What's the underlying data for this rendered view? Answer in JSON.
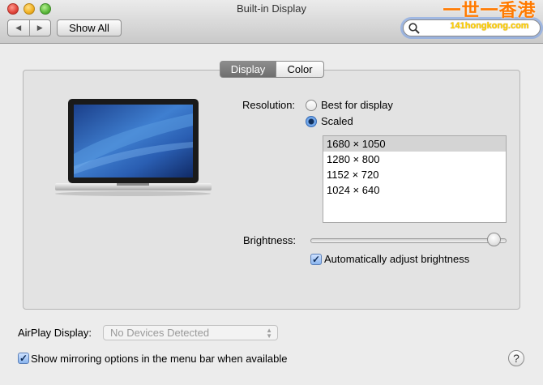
{
  "window": {
    "title": "Built-in Display"
  },
  "toolbar": {
    "back_glyph": "◀",
    "forward_glyph": "▶",
    "show_all_label": "Show All",
    "search_value": ""
  },
  "watermark": {
    "line1": "一世一香港",
    "line2": "141hongkong.com"
  },
  "tabs": [
    {
      "label": "Display",
      "selected": true
    },
    {
      "label": "Color",
      "selected": false
    }
  ],
  "display": {
    "resolution_label": "Resolution:",
    "resolution_options": [
      {
        "label": "Best for display",
        "selected": false
      },
      {
        "label": "Scaled",
        "selected": true
      }
    ],
    "resolutions": [
      "1680 × 1050",
      "1280 × 800",
      "1152 × 720",
      "1024 × 640"
    ],
    "selected_resolution": "1680 × 1050",
    "brightness_label": "Brightness:",
    "brightness_level": 0.94,
    "auto_brightness_label": "Automatically adjust brightness",
    "auto_brightness_checked": true
  },
  "airplay": {
    "label": "AirPlay Display:",
    "value": "No Devices Detected",
    "enabled": false
  },
  "mirroring": {
    "label": "Show mirroring options in the menu bar when available",
    "checked": true
  },
  "help": {
    "glyph": "?"
  },
  "icons": {
    "search": "search-icon",
    "laptop": "laptop-icon",
    "help": "help-icon"
  },
  "colors": {
    "selected_tab": "#7a7a7a",
    "selection_row": "#d4d4d4",
    "radio_on": "#4a86d8",
    "checkbox": "#8ab4ee",
    "search_glow": "#78a0e6"
  }
}
